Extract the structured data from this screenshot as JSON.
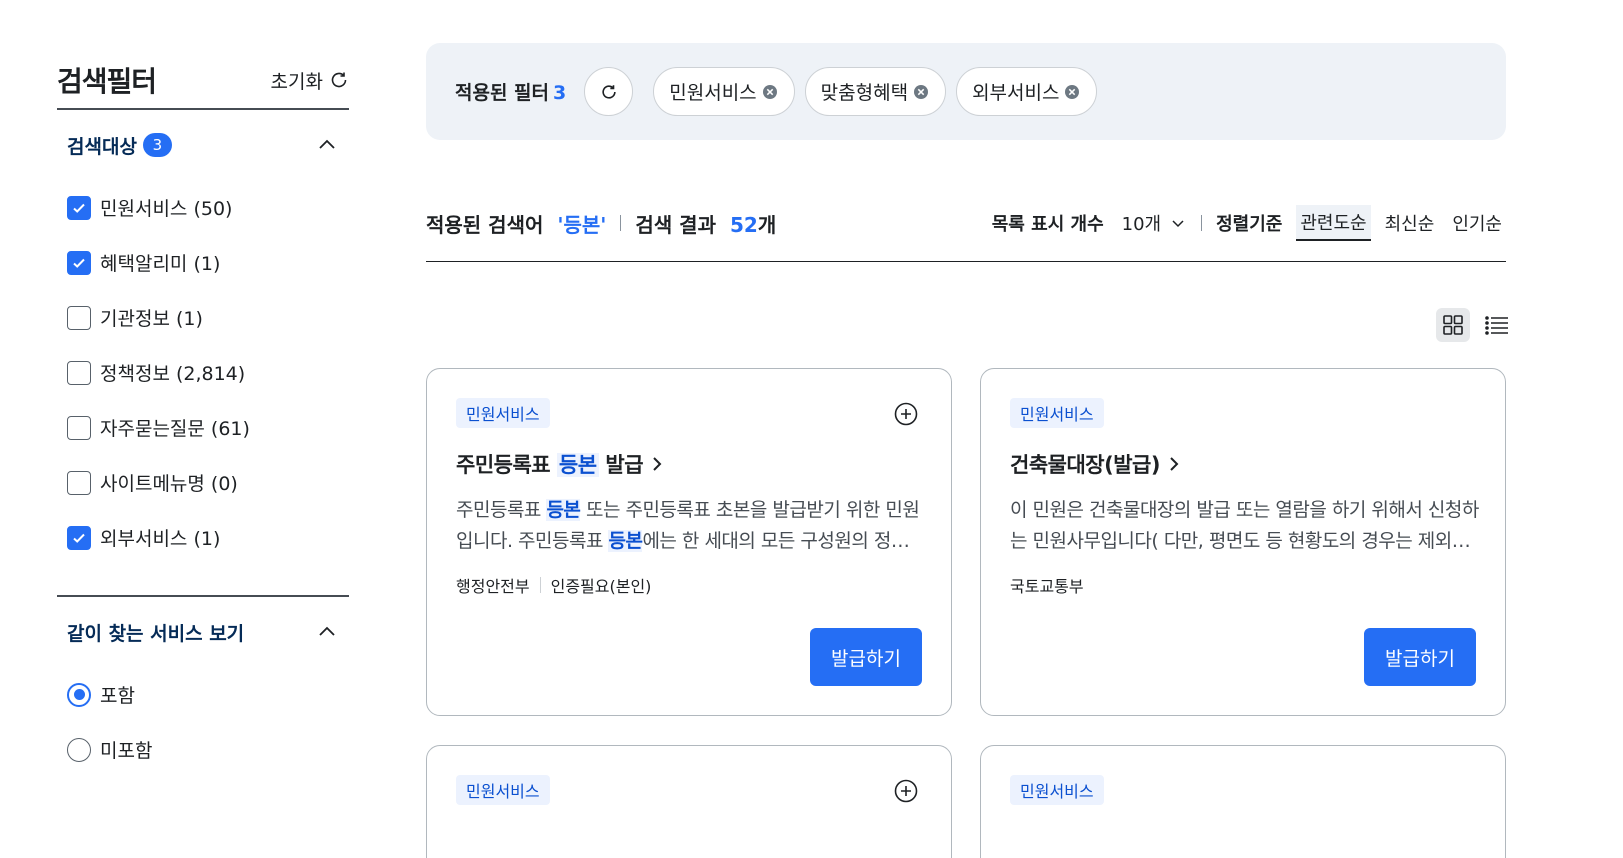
{
  "sidebar": {
    "title": "검색필터",
    "reset_label": "초기화",
    "search_target": {
      "title": "검색대상",
      "badge": "3",
      "items": [
        {
          "label": "민원서비스 (50)",
          "checked": true
        },
        {
          "label": "혜택알리미 (1)",
          "checked": true
        },
        {
          "label": "기관정보 (1)",
          "checked": false
        },
        {
          "label": "정책정보 (2,814)",
          "checked": false
        },
        {
          "label": "자주묻는질문 (61)",
          "checked": false
        },
        {
          "label": "사이트메뉴명 (0)",
          "checked": false
        },
        {
          "label": "외부서비스 (1)",
          "checked": true
        }
      ]
    },
    "related": {
      "title": "같이 찾는 서비스 보기",
      "options": [
        {
          "label": "포함",
          "selected": true
        },
        {
          "label": "미포함",
          "selected": false
        }
      ]
    }
  },
  "filter_bar": {
    "label": "적용된 필터",
    "count": "3",
    "chips": [
      "민원서비스",
      "맞춤형혜택",
      "외부서비스"
    ]
  },
  "result_bar": {
    "query_label": "적용된 검색어",
    "query": "'등본'",
    "result_label": "검색 결과",
    "result_count": "52",
    "result_unit": "개",
    "size_label": "목록 표시 개수",
    "size_value": "10개",
    "sort_label": "정렬기준",
    "sort_options": [
      "관련도순",
      "최신순",
      "인기순"
    ]
  },
  "cards": [
    {
      "tag": "민원서비스",
      "title_pre": "주민등록표 ",
      "title_hl": "등본",
      "title_post": " 발급",
      "desc_1": "주민등록표 ",
      "desc_hl1": "등본",
      "desc_2": " 또는 주민등록표 초본을 발급받기 위한 민원입니다. 주민등록표 ",
      "desc_hl2": "등본",
      "desc_3": "에는 한 세대의 모든 구성원의 정보가 기재되어 있습니다.",
      "agency": "행정안전부",
      "auth": "인증필요(본인)",
      "button": "발급하기"
    },
    {
      "tag": "민원서비스",
      "title": "건축물대장(발급)",
      "desc": "이 민원은 건축물대장의 발급 또는 열람을 하기 위해서 신청하는 민원사무입니다( 다만, 평면도 등 현황도의 경우는 제외합니다).",
      "agency": "국토교통부",
      "button": "발급하기"
    },
    {
      "tag": "민원서비스"
    },
    {
      "tag": "민원서비스"
    }
  ]
}
